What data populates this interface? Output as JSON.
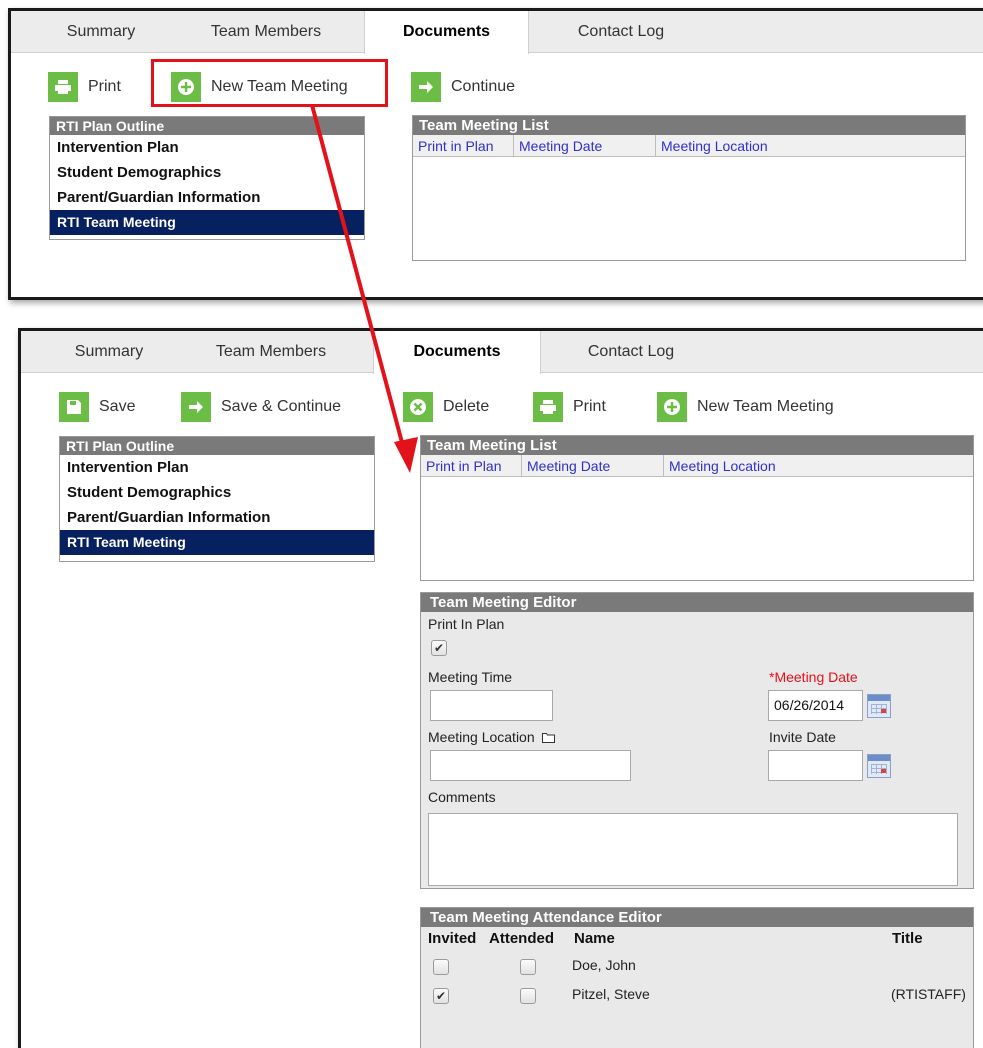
{
  "top": {
    "tabs": [
      "Summary",
      "Team Members",
      "Documents",
      "Contact Log"
    ],
    "active_tab": "Documents",
    "toolbar": {
      "print": "Print",
      "new_team_meeting": "New Team Meeting",
      "continue": "Continue"
    },
    "outline": {
      "header": "RTI Plan Outline",
      "items": [
        "Intervention Plan",
        "Student Demographics",
        "Parent/Guardian Information",
        "RTI Team Meeting"
      ],
      "selected": "RTI Team Meeting"
    },
    "meeting_list": {
      "header": "Team Meeting List",
      "columns": [
        "Print in Plan",
        "Meeting Date",
        "Meeting Location"
      ]
    }
  },
  "bottom": {
    "tabs": [
      "Summary",
      "Team Members",
      "Documents",
      "Contact Log"
    ],
    "active_tab": "Documents",
    "toolbar": {
      "save": "Save",
      "save_continue": "Save & Continue",
      "delete": "Delete",
      "print": "Print",
      "new_team_meeting": "New Team Meeting"
    },
    "outline": {
      "header": "RTI Plan Outline",
      "items": [
        "Intervention Plan",
        "Student Demographics",
        "Parent/Guardian Information",
        "RTI Team Meeting"
      ],
      "selected": "RTI Team Meeting"
    },
    "meeting_list": {
      "header": "Team Meeting List",
      "columns": [
        "Print in Plan",
        "Meeting Date",
        "Meeting Location"
      ]
    },
    "editor": {
      "header": "Team Meeting Editor",
      "print_in_plan_label": "Print In Plan",
      "print_in_plan_checked": true,
      "meeting_time_label": "Meeting Time",
      "meeting_time_value": "",
      "meeting_date_label": "*Meeting Date",
      "meeting_date_value": "06/26/2014",
      "meeting_location_label": "Meeting Location",
      "meeting_location_value": "",
      "invite_date_label": "Invite Date",
      "invite_date_value": "",
      "comments_label": "Comments",
      "comments_value": ""
    },
    "attendance": {
      "header": "Team Meeting Attendance Editor",
      "columns": {
        "invited": "Invited",
        "attended": "Attended",
        "name": "Name",
        "title": "Title"
      },
      "rows": [
        {
          "invited": false,
          "attended": false,
          "name": "Doe, John",
          "title": ""
        },
        {
          "invited": true,
          "attended": false,
          "name": "Pitzel, Steve",
          "title": "(RTISTAFF)"
        }
      ]
    }
  },
  "colors": {
    "accent_green": "#6cbd45",
    "selected_navy": "#072060",
    "header_gray": "#7a7a7a",
    "annotation_red": "#e3121a",
    "required_red": "#e8101a",
    "link_blue": "#3030cc"
  },
  "icons": [
    "print-icon",
    "plus-circle-icon",
    "arrow-right-icon",
    "save-icon",
    "delete-icon",
    "calendar-icon",
    "folder-icon"
  ]
}
